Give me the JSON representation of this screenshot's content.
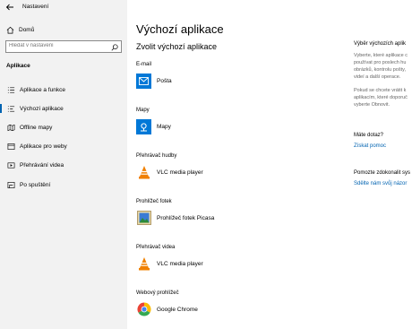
{
  "window": {
    "title": "Nastavení"
  },
  "sidebar": {
    "home": "Domů",
    "search_placeholder": "Hledat v nastavení",
    "section": "Aplikace",
    "items": [
      {
        "label": "Aplikace a funkce",
        "icon": "list-icon"
      },
      {
        "label": "Výchozí aplikace",
        "icon": "default-apps-icon",
        "active": true
      },
      {
        "label": "Offline mapy",
        "icon": "map-icon"
      },
      {
        "label": "Aplikace pro weby",
        "icon": "web-apps-icon"
      },
      {
        "label": "Přehrávání videa",
        "icon": "video-icon"
      },
      {
        "label": "Po spuštění",
        "icon": "startup-icon"
      }
    ]
  },
  "main": {
    "title": "Výchozí aplikace",
    "subtitle": "Zvolit výchozí aplikace",
    "categories": [
      {
        "label": "E-mail",
        "app": "Pošta",
        "icon": "mail-icon",
        "color": "#0078d7"
      },
      {
        "label": "Mapy",
        "app": "Mapy",
        "icon": "maps-icon",
        "color": "#0078d7"
      },
      {
        "label": "Přehrávač hudby",
        "app": "VLC media player",
        "icon": "vlc-icon",
        "color": "#f08000"
      },
      {
        "label": "Prohlížeč fotek",
        "app": "Prohlížeč fotek Picasa",
        "icon": "picasa-icon",
        "color": "#3a7bd5"
      },
      {
        "label": "Přehrávač videa",
        "app": "VLC media player",
        "icon": "vlc-icon",
        "color": "#f08000"
      },
      {
        "label": "Webový prohlížeč",
        "app": "Google Chrome",
        "icon": "chrome-icon",
        "color": "#4285f4"
      }
    ]
  },
  "right": {
    "heading1": "Výběr výchozích aplik",
    "text1": [
      "Vyberte, které aplikace c",
      "používat pro poslech hu",
      "obrázků, kontrolu pošty,",
      "videí a další operace."
    ],
    "text2": [
      "Pokud se chcete vrátit k",
      "aplikacím, které doporuč",
      "vyberte Obnovit."
    ],
    "heading2": "Máte dotaz?",
    "link1": "Získat pomoc",
    "heading3": "Pomozte zdokonalit sys",
    "link2": "Sdělte nám svůj názor"
  }
}
